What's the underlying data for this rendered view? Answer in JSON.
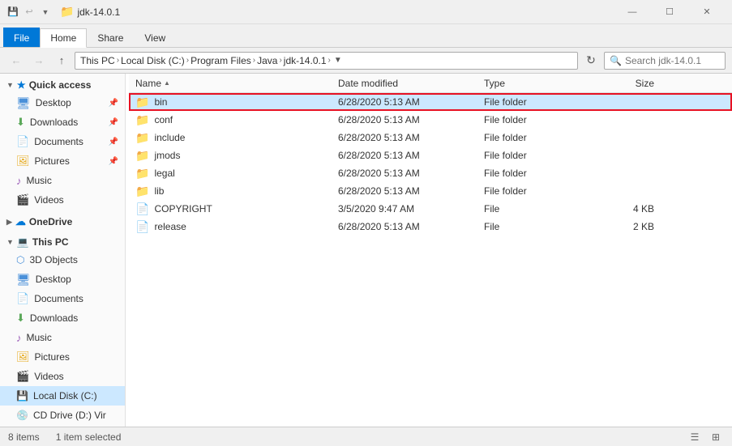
{
  "titleBar": {
    "title": "jdk-14.0.1",
    "minimize": "—",
    "maximize": "☐",
    "close": "✕"
  },
  "ribbon": {
    "tabs": [
      "File",
      "Home",
      "Share",
      "View"
    ]
  },
  "addressBar": {
    "back": "←",
    "forward": "→",
    "up": "↑",
    "path": [
      "This PC",
      "Local Disk (C:)",
      "Program Files",
      "Java",
      "jdk-14.0.1"
    ],
    "search_placeholder": "Search jdk-14.0.1"
  },
  "sidebar": {
    "quickAccess": {
      "label": "Quick access",
      "items": [
        {
          "name": "Desktop",
          "pinned": true
        },
        {
          "name": "Downloads",
          "pinned": true
        },
        {
          "name": "Documents",
          "pinned": true
        },
        {
          "name": "Pictures",
          "pinned": true
        },
        {
          "name": "Music",
          "pinned": false
        },
        {
          "name": "Videos",
          "pinned": false
        }
      ]
    },
    "oneDrive": {
      "label": "OneDrive"
    },
    "thisPC": {
      "label": "This PC",
      "items": [
        {
          "name": "3D Objects"
        },
        {
          "name": "Desktop"
        },
        {
          "name": "Documents"
        },
        {
          "name": "Downloads"
        },
        {
          "name": "Music"
        },
        {
          "name": "Pictures"
        },
        {
          "name": "Videos"
        },
        {
          "name": "Local Disk (C:)",
          "active": true
        },
        {
          "name": "CD Drive (D:) Vir"
        }
      ]
    }
  },
  "fileList": {
    "columns": {
      "name": "Name",
      "dateModified": "Date modified",
      "type": "Type",
      "size": "Size"
    },
    "items": [
      {
        "name": "bin",
        "date": "6/28/2020 5:13 AM",
        "type": "File folder",
        "size": "",
        "isFolder": true,
        "selected": true
      },
      {
        "name": "conf",
        "date": "6/28/2020 5:13 AM",
        "type": "File folder",
        "size": "",
        "isFolder": true,
        "selected": false
      },
      {
        "name": "include",
        "date": "6/28/2020 5:13 AM",
        "type": "File folder",
        "size": "",
        "isFolder": true,
        "selected": false
      },
      {
        "name": "jmods",
        "date": "6/28/2020 5:13 AM",
        "type": "File folder",
        "size": "",
        "isFolder": true,
        "selected": false
      },
      {
        "name": "legal",
        "date": "6/28/2020 5:13 AM",
        "type": "File folder",
        "size": "",
        "isFolder": true,
        "selected": false
      },
      {
        "name": "lib",
        "date": "6/28/2020 5:13 AM",
        "type": "File folder",
        "size": "",
        "isFolder": true,
        "selected": false
      },
      {
        "name": "COPYRIGHT",
        "date": "3/5/2020 9:47 AM",
        "type": "File",
        "size": "4 KB",
        "isFolder": false,
        "selected": false
      },
      {
        "name": "release",
        "date": "6/28/2020 5:13 AM",
        "type": "File",
        "size": "2 KB",
        "isFolder": false,
        "selected": false
      }
    ]
  },
  "statusBar": {
    "itemCount": "8 items",
    "selectedInfo": "1 item selected"
  }
}
